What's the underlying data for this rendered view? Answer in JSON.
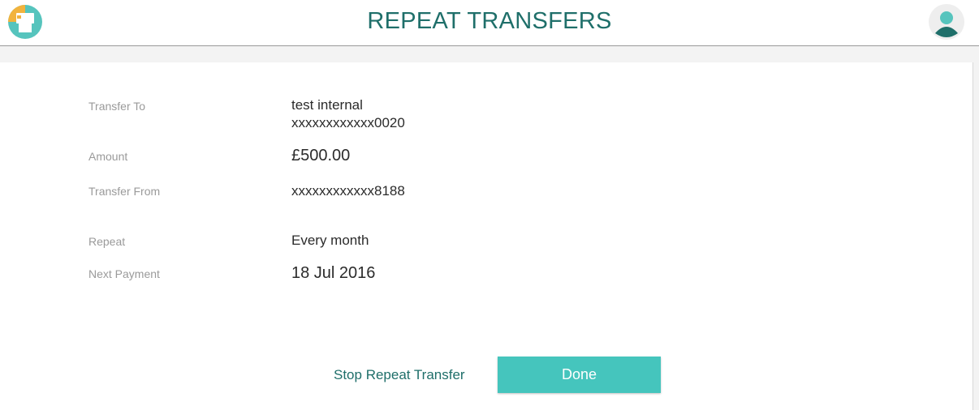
{
  "header": {
    "title": "REPEAT TRANSFERS",
    "logo_icon": "printer-app-logo-icon",
    "avatar_icon": "user-avatar-icon"
  },
  "details": {
    "transfer_to_label": "Transfer To",
    "transfer_to_name": "test internal",
    "transfer_to_account": "xxxxxxxxxxxx0020",
    "amount_label": "Amount",
    "amount_value": "£500.00",
    "transfer_from_label": "Transfer From",
    "transfer_from_account": "xxxxxxxxxxxx8188",
    "repeat_label": "Repeat",
    "repeat_value": "Every month",
    "next_payment_label": "Next Payment",
    "next_payment_value": "18 Jul 2016"
  },
  "actions": {
    "stop_label": "Stop Repeat Transfer",
    "done_label": "Done"
  },
  "colors": {
    "accent": "#45c5bd",
    "title": "#1f6f6a",
    "label": "#9a9a9a"
  }
}
